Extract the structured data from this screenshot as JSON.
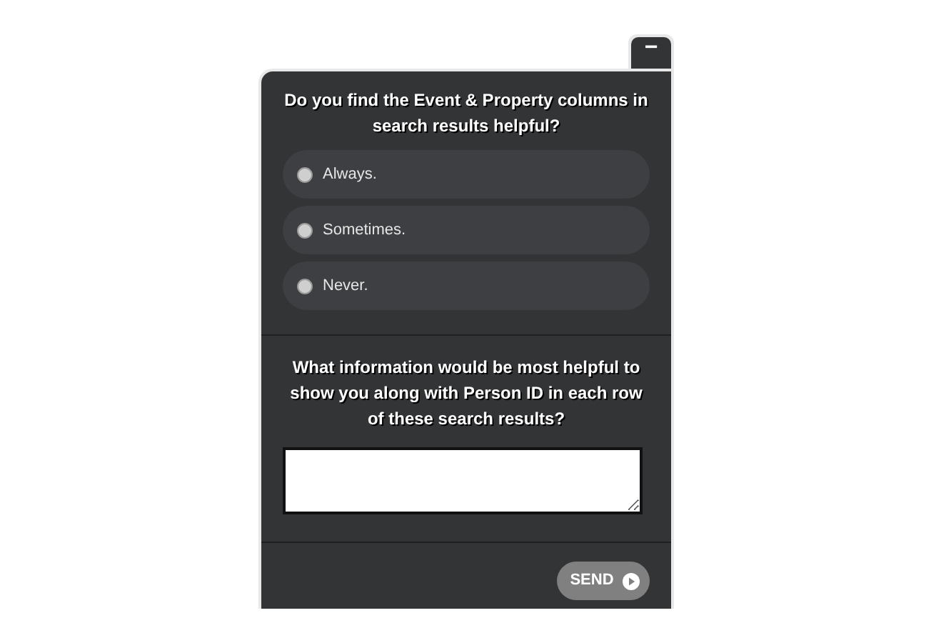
{
  "survey": {
    "minimize_button": "−",
    "question_1": "Do you find the Event & Property columns in search results helpful?",
    "options": [
      {
        "label": "Always.",
        "selected": false
      },
      {
        "label": "Sometimes.",
        "selected": false
      },
      {
        "label": "Never.",
        "selected": false
      }
    ],
    "question_2": "What information would be most helpful to show you along with Person ID in each row of these search results?",
    "send_button": "SEND"
  }
}
